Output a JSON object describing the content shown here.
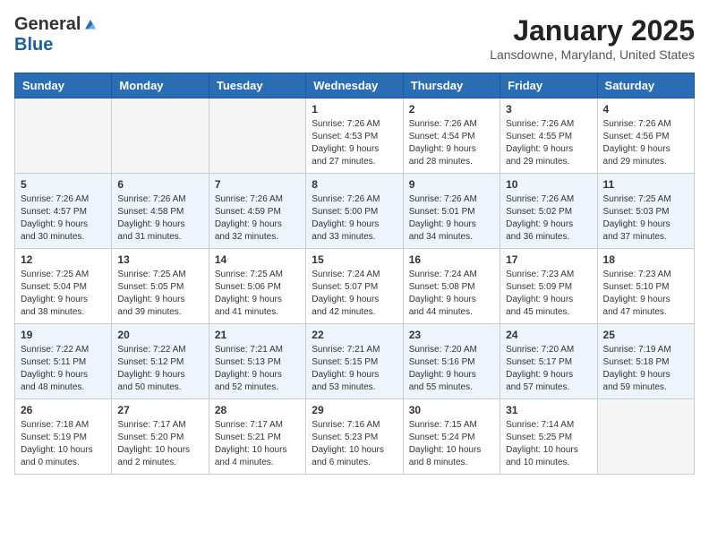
{
  "header": {
    "logo_general": "General",
    "logo_blue": "Blue",
    "month": "January 2025",
    "location": "Lansdowne, Maryland, United States"
  },
  "days_of_week": [
    "Sunday",
    "Monday",
    "Tuesday",
    "Wednesday",
    "Thursday",
    "Friday",
    "Saturday"
  ],
  "weeks": [
    [
      {
        "day": "",
        "info": ""
      },
      {
        "day": "",
        "info": ""
      },
      {
        "day": "",
        "info": ""
      },
      {
        "day": "1",
        "info": "Sunrise: 7:26 AM\nSunset: 4:53 PM\nDaylight: 9 hours\nand 27 minutes."
      },
      {
        "day": "2",
        "info": "Sunrise: 7:26 AM\nSunset: 4:54 PM\nDaylight: 9 hours\nand 28 minutes."
      },
      {
        "day": "3",
        "info": "Sunrise: 7:26 AM\nSunset: 4:55 PM\nDaylight: 9 hours\nand 29 minutes."
      },
      {
        "day": "4",
        "info": "Sunrise: 7:26 AM\nSunset: 4:56 PM\nDaylight: 9 hours\nand 29 minutes."
      }
    ],
    [
      {
        "day": "5",
        "info": "Sunrise: 7:26 AM\nSunset: 4:57 PM\nDaylight: 9 hours\nand 30 minutes."
      },
      {
        "day": "6",
        "info": "Sunrise: 7:26 AM\nSunset: 4:58 PM\nDaylight: 9 hours\nand 31 minutes."
      },
      {
        "day": "7",
        "info": "Sunrise: 7:26 AM\nSunset: 4:59 PM\nDaylight: 9 hours\nand 32 minutes."
      },
      {
        "day": "8",
        "info": "Sunrise: 7:26 AM\nSunset: 5:00 PM\nDaylight: 9 hours\nand 33 minutes."
      },
      {
        "day": "9",
        "info": "Sunrise: 7:26 AM\nSunset: 5:01 PM\nDaylight: 9 hours\nand 34 minutes."
      },
      {
        "day": "10",
        "info": "Sunrise: 7:26 AM\nSunset: 5:02 PM\nDaylight: 9 hours\nand 36 minutes."
      },
      {
        "day": "11",
        "info": "Sunrise: 7:25 AM\nSunset: 5:03 PM\nDaylight: 9 hours\nand 37 minutes."
      }
    ],
    [
      {
        "day": "12",
        "info": "Sunrise: 7:25 AM\nSunset: 5:04 PM\nDaylight: 9 hours\nand 38 minutes."
      },
      {
        "day": "13",
        "info": "Sunrise: 7:25 AM\nSunset: 5:05 PM\nDaylight: 9 hours\nand 39 minutes."
      },
      {
        "day": "14",
        "info": "Sunrise: 7:25 AM\nSunset: 5:06 PM\nDaylight: 9 hours\nand 41 minutes."
      },
      {
        "day": "15",
        "info": "Sunrise: 7:24 AM\nSunset: 5:07 PM\nDaylight: 9 hours\nand 42 minutes."
      },
      {
        "day": "16",
        "info": "Sunrise: 7:24 AM\nSunset: 5:08 PM\nDaylight: 9 hours\nand 44 minutes."
      },
      {
        "day": "17",
        "info": "Sunrise: 7:23 AM\nSunset: 5:09 PM\nDaylight: 9 hours\nand 45 minutes."
      },
      {
        "day": "18",
        "info": "Sunrise: 7:23 AM\nSunset: 5:10 PM\nDaylight: 9 hours\nand 47 minutes."
      }
    ],
    [
      {
        "day": "19",
        "info": "Sunrise: 7:22 AM\nSunset: 5:11 PM\nDaylight: 9 hours\nand 48 minutes."
      },
      {
        "day": "20",
        "info": "Sunrise: 7:22 AM\nSunset: 5:12 PM\nDaylight: 9 hours\nand 50 minutes."
      },
      {
        "day": "21",
        "info": "Sunrise: 7:21 AM\nSunset: 5:13 PM\nDaylight: 9 hours\nand 52 minutes."
      },
      {
        "day": "22",
        "info": "Sunrise: 7:21 AM\nSunset: 5:15 PM\nDaylight: 9 hours\nand 53 minutes."
      },
      {
        "day": "23",
        "info": "Sunrise: 7:20 AM\nSunset: 5:16 PM\nDaylight: 9 hours\nand 55 minutes."
      },
      {
        "day": "24",
        "info": "Sunrise: 7:20 AM\nSunset: 5:17 PM\nDaylight: 9 hours\nand 57 minutes."
      },
      {
        "day": "25",
        "info": "Sunrise: 7:19 AM\nSunset: 5:18 PM\nDaylight: 9 hours\nand 59 minutes."
      }
    ],
    [
      {
        "day": "26",
        "info": "Sunrise: 7:18 AM\nSunset: 5:19 PM\nDaylight: 10 hours\nand 0 minutes."
      },
      {
        "day": "27",
        "info": "Sunrise: 7:17 AM\nSunset: 5:20 PM\nDaylight: 10 hours\nand 2 minutes."
      },
      {
        "day": "28",
        "info": "Sunrise: 7:17 AM\nSunset: 5:21 PM\nDaylight: 10 hours\nand 4 minutes."
      },
      {
        "day": "29",
        "info": "Sunrise: 7:16 AM\nSunset: 5:23 PM\nDaylight: 10 hours\nand 6 minutes."
      },
      {
        "day": "30",
        "info": "Sunrise: 7:15 AM\nSunset: 5:24 PM\nDaylight: 10 hours\nand 8 minutes."
      },
      {
        "day": "31",
        "info": "Sunrise: 7:14 AM\nSunset: 5:25 PM\nDaylight: 10 hours\nand 10 minutes."
      },
      {
        "day": "",
        "info": ""
      }
    ]
  ]
}
